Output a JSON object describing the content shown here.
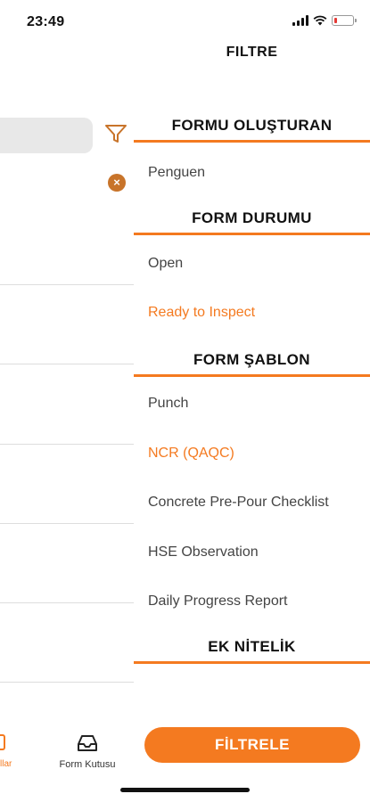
{
  "status_bar": {
    "time": "23:49",
    "battery_level": 0.2,
    "battery_color": "#e53935"
  },
  "background": {
    "icons": [
      "filter-icon",
      "clear-filter-icon"
    ],
    "tabs": {
      "partial_label": "llar",
      "inbox_label": "Form Kutusu"
    }
  },
  "filter_panel": {
    "title": "FILTRE",
    "accent_color": "#f47a20",
    "sections": [
      {
        "header": "FORMU OLUŞTURAN",
        "options": [
          {
            "label": "Penguen",
            "selected": false
          }
        ]
      },
      {
        "header": "FORM DURUMU",
        "options": [
          {
            "label": "Open",
            "selected": false
          },
          {
            "label": "Ready to Inspect",
            "selected": true
          }
        ]
      },
      {
        "header": "FORM ŞABLON",
        "options": [
          {
            "label": "Punch",
            "selected": false
          },
          {
            "label": "NCR (QAQC)",
            "selected": true
          },
          {
            "label": "Concrete Pre-Pour Checklist",
            "selected": false
          },
          {
            "label": "HSE Observation",
            "selected": false
          },
          {
            "label": "Daily Progress Report",
            "selected": false
          }
        ]
      },
      {
        "header": "EK NİTELİK",
        "options": []
      }
    ],
    "apply_label": "FİLTRELE"
  }
}
